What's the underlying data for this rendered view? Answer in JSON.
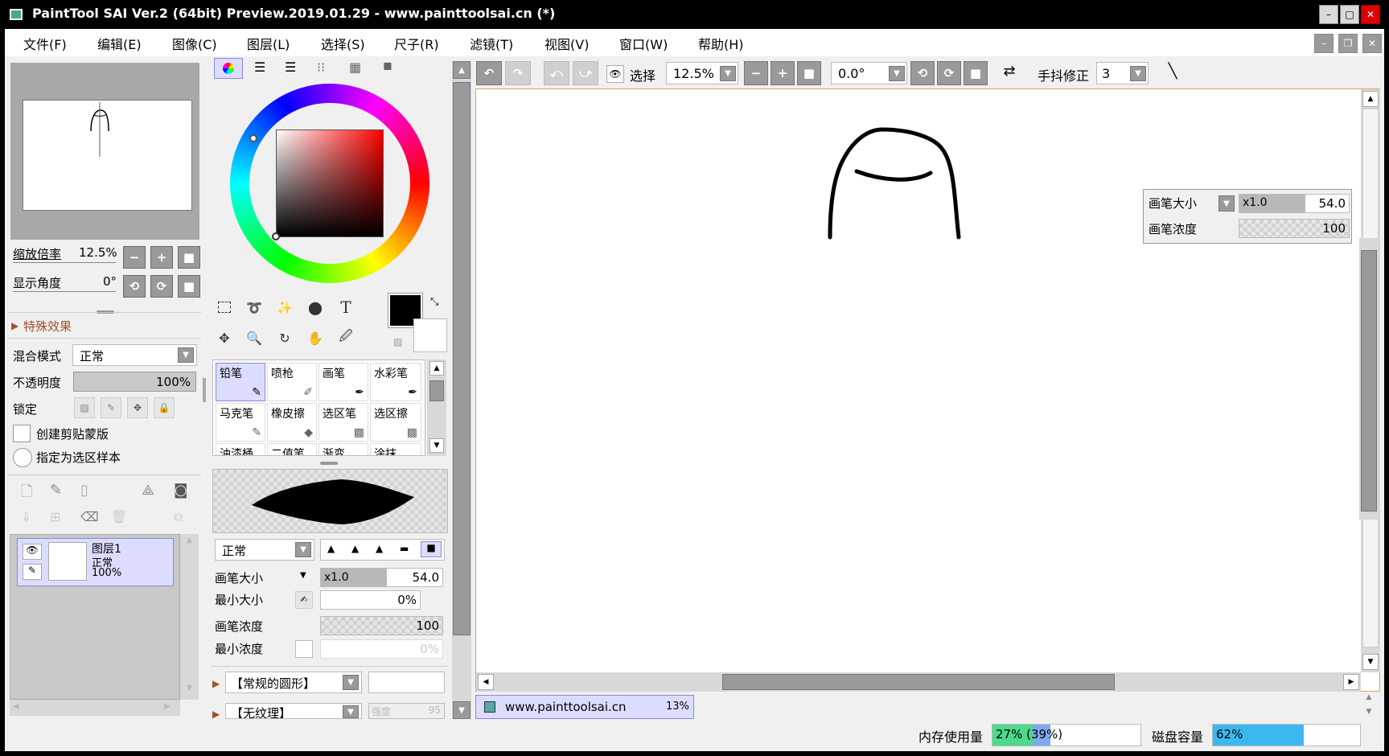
{
  "window": {
    "title": "PaintTool SAI Ver.2 (64bit) Preview.2019.01.29 - www.painttoolsai.cn (*)",
    "min": "–",
    "max": "□",
    "close": "✕"
  },
  "menu": [
    "文件(F)",
    "编辑(E)",
    "图像(C)",
    "图层(L)",
    "选择(S)",
    "尺子(R)",
    "滤镜(T)",
    "视图(V)",
    "窗口(W)",
    "帮助(H)"
  ],
  "nav": {
    "zoom_label": "缩放倍率",
    "zoom_value": "12.5%",
    "angle_label": "显示角度",
    "angle_value": "0°"
  },
  "layer_props": {
    "effects_label": "特殊效果",
    "blend_label": "混合模式",
    "blend_value": "正常",
    "opacity_label": "不透明度",
    "opacity_value": "100%",
    "lock_label": "锁定",
    "clip_label": "创建剪贴蒙版",
    "sample_label": "指定为选区样本"
  },
  "layers": [
    {
      "name": "图层1",
      "mode": "正常",
      "opacity": "100%"
    }
  ],
  "brushes": {
    "row1": [
      "铅笔",
      "喷枪",
      "画笔",
      "水彩笔"
    ],
    "row2": [
      "马克笔",
      "橡皮擦",
      "选区笔",
      "选区擦"
    ],
    "row3": [
      "油漆桶",
      "二值笔",
      "渐变",
      "涂抹"
    ]
  },
  "brush_settings": {
    "mode_value": "正常",
    "size_label": "画笔大小",
    "size_mult": "x1.0",
    "size_value": "54.0",
    "min_size_label": "最小大小",
    "min_size_value": "0%",
    "density_label": "画笔浓度",
    "density_value": "100",
    "min_density_label": "最小浓度",
    "min_density_value": "0%",
    "shape_value": "【常规的圆形】",
    "texture_value": "【无纹理】",
    "texture_strength_label": "强度",
    "texture_strength_value": "95"
  },
  "toolbar": {
    "select_label": "选择",
    "zoom_value": "12.5%",
    "angle_value": "0.0°",
    "stabilizer_label": "手抖修正",
    "stabilizer_value": "3"
  },
  "overlay": {
    "size_label": "画笔大小",
    "size_mult": "x1.0",
    "size_value": "54.0",
    "density_label": "画笔浓度",
    "density_value": "100"
  },
  "canvas_tab": {
    "name": "www.painttoolsai.cn",
    "zoom": "13%"
  },
  "status": {
    "memory_label": "内存使用量",
    "memory_value": "27% (39%)",
    "memory_fraction": 0.27,
    "memory_fraction_total": 0.39,
    "disk_label": "磁盘容量",
    "disk_value": "62%",
    "disk_fraction": 0.62
  },
  "colors": {
    "accent_orange": "#f0a050",
    "memory_green": "#4cd98a",
    "memory_blue": "#7fa8f0",
    "disk_blue": "#3cb8f0",
    "selected_layer": "#dcdcff"
  }
}
